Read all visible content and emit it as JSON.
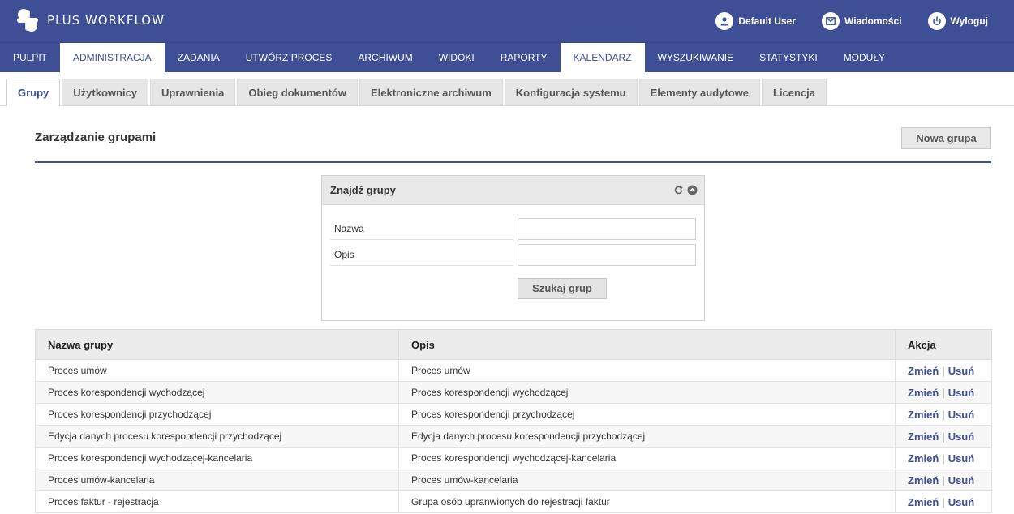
{
  "header": {
    "logo_text_a": "PLUS",
    "logo_text_b": "WORKFLOW",
    "user_label": "Default User",
    "messages_label": "Wiadomości",
    "logout_label": "Wyloguj"
  },
  "main_nav": [
    {
      "label": "PULPIT",
      "active": false
    },
    {
      "label": "ADMINISTRACJA",
      "active": true
    },
    {
      "label": "ZADANIA",
      "active": false
    },
    {
      "label": "UTWÓRZ PROCES",
      "active": false
    },
    {
      "label": "ARCHIWUM",
      "active": false
    },
    {
      "label": "WIDOKI",
      "active": false
    },
    {
      "label": "RAPORTY",
      "active": false
    },
    {
      "label": "KALENDARZ",
      "active": true
    },
    {
      "label": "WYSZUKIWANIE",
      "active": false
    },
    {
      "label": "STATYSTYKI",
      "active": false
    },
    {
      "label": "MODUŁY",
      "active": false
    }
  ],
  "sub_tabs": [
    {
      "label": "Grupy",
      "active": true
    },
    {
      "label": "Użytkownicy",
      "active": false
    },
    {
      "label": "Uprawnienia",
      "active": false
    },
    {
      "label": "Obieg dokumentów",
      "active": false
    },
    {
      "label": "Elektroniczne archiwum",
      "active": false
    },
    {
      "label": "Konfiguracja systemu",
      "active": false
    },
    {
      "label": "Elementy audytowe",
      "active": false
    },
    {
      "label": "Licencja",
      "active": false
    }
  ],
  "page": {
    "title": "Zarządzanie grupami",
    "new_group_label": "Nowa grupa"
  },
  "search": {
    "title": "Znajdź grupy",
    "name_label": "Nazwa",
    "name_value": "",
    "desc_label": "Opis",
    "desc_value": "",
    "button_label": "Szukaj grup"
  },
  "table": {
    "headers": {
      "name": "Nazwa grupy",
      "desc": "Opis",
      "action": "Akcja"
    },
    "edit_label": "Zmień",
    "separator": "|",
    "delete_label": "Usuń",
    "rows": [
      {
        "name": "Proces umów",
        "desc": "Proces umów"
      },
      {
        "name": "Proces korespondencji wychodzącej",
        "desc": "Proces korespondencji wychodzącej"
      },
      {
        "name": "Proces korespondencji przychodzącej",
        "desc": "Proces korespondencji przychodzącej"
      },
      {
        "name": "Edycja danych procesu korespondencji przychodzącej",
        "desc": "Edycja danych procesu korespondencji przychodzącej"
      },
      {
        "name": "Proces korespondencji wychodzącej-kancelaria",
        "desc": "Proces korespondencji wychodzącej-kancelaria"
      },
      {
        "name": "Proces umów-kancelaria",
        "desc": "Proces umów-kancelaria"
      },
      {
        "name": "Proces faktur - rejestracja",
        "desc": "Grupa osób upranwionych do rejestracji faktur"
      }
    ]
  },
  "colors": {
    "brand": "#3e4f96",
    "header_bg": "#3e4f96"
  },
  "icons": {
    "logo": "plus-logo-icon",
    "user": "user-icon",
    "messages": "envelope-icon",
    "logout": "power-icon",
    "refresh": "refresh-icon",
    "collapse": "chevron-up-circle-icon"
  }
}
